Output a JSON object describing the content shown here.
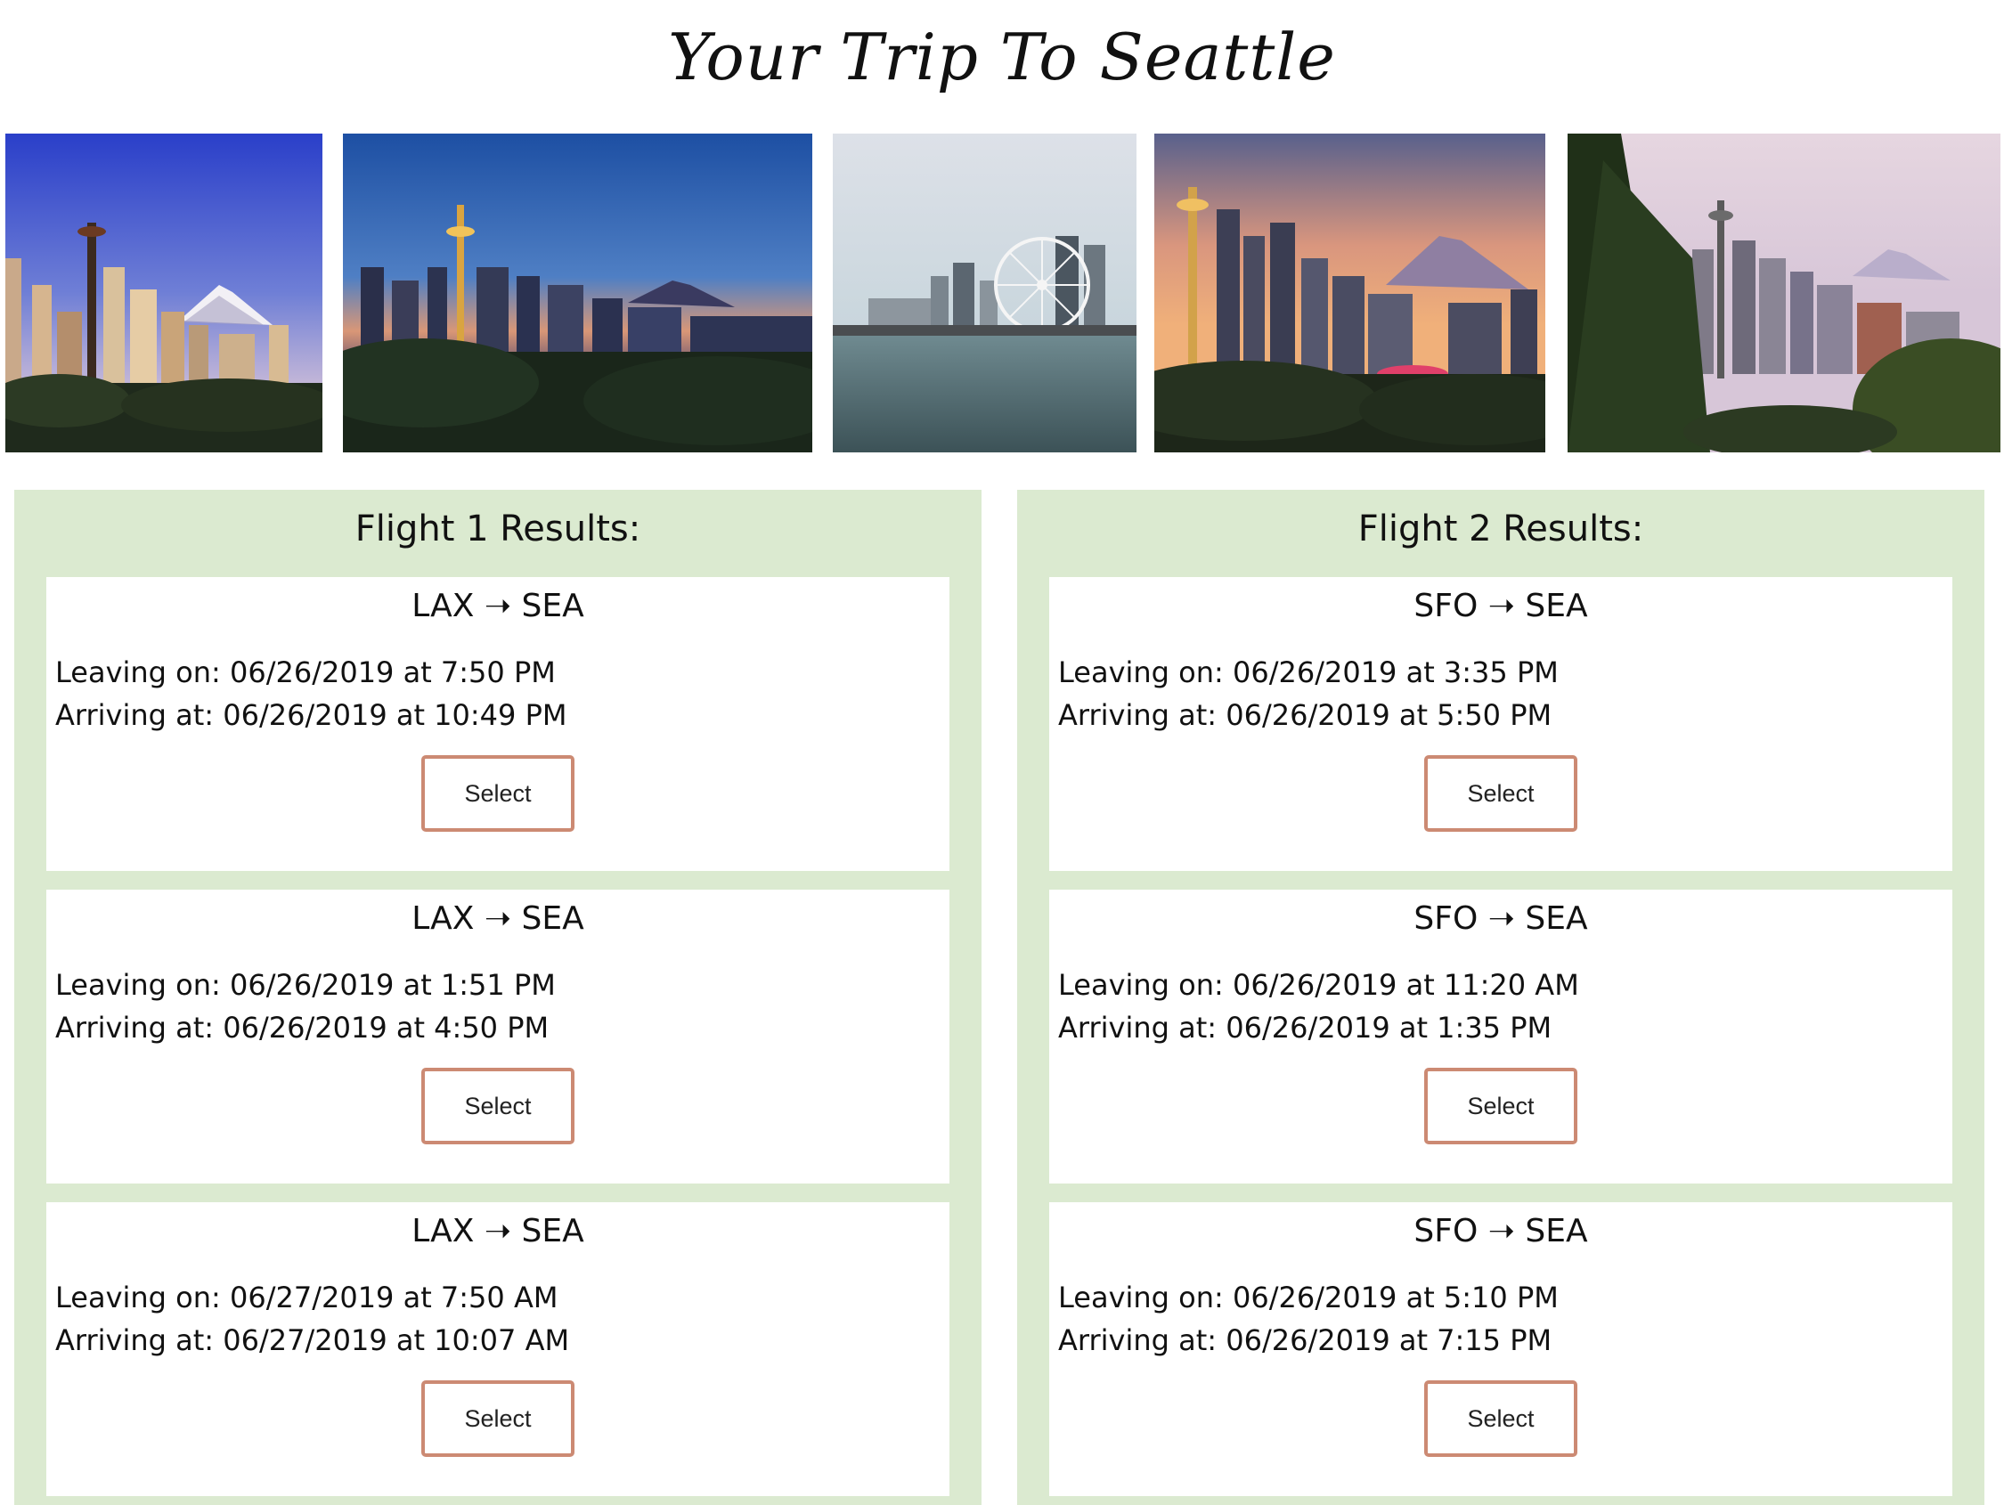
{
  "header": {
    "title": "Your Trip To Seattle"
  },
  "gallery": {
    "photos": [
      {
        "name": "seattle-skyline-blue-sky-photo"
      },
      {
        "name": "seattle-skyline-dusk-photo"
      },
      {
        "name": "seattle-waterfront-ferris-wheel-photo"
      },
      {
        "name": "seattle-skyline-sunset-photo"
      },
      {
        "name": "seattle-skyline-trees-photo"
      }
    ]
  },
  "colors": {
    "panel_background": "#dbead0",
    "card_background": "#ffffff",
    "button_border": "#cc8a73"
  },
  "flight1": {
    "heading": "Flight 1 Results:",
    "results": [
      {
        "route": "LAX ➝ SEA",
        "leaving": "Leaving on: 06/26/2019 at 7:50 PM",
        "arriving": "Arriving at: 06/26/2019 at 10:49 PM",
        "button": "Select"
      },
      {
        "route": "LAX ➝ SEA",
        "leaving": "Leaving on: 06/26/2019 at 1:51 PM",
        "arriving": "Arriving at: 06/26/2019 at 4:50 PM",
        "button": "Select"
      },
      {
        "route": "LAX ➝ SEA",
        "leaving": "Leaving on: 06/27/2019 at 7:50 AM",
        "arriving": "Arriving at: 06/27/2019 at 10:07 AM",
        "button": "Select"
      }
    ]
  },
  "flight2": {
    "heading": "Flight 2 Results:",
    "results": [
      {
        "route": "SFO ➝ SEA",
        "leaving": "Leaving on: 06/26/2019 at 3:35 PM",
        "arriving": "Arriving at: 06/26/2019 at 5:50 PM",
        "button": "Select"
      },
      {
        "route": "SFO ➝ SEA",
        "leaving": "Leaving on: 06/26/2019 at 11:20 AM",
        "arriving": "Arriving at: 06/26/2019 at 1:35 PM",
        "button": "Select"
      },
      {
        "route": "SFO ➝ SEA",
        "leaving": "Leaving on: 06/26/2019 at 5:10 PM",
        "arriving": "Arriving at: 06/26/2019 at 7:15 PM",
        "button": "Select"
      }
    ]
  }
}
